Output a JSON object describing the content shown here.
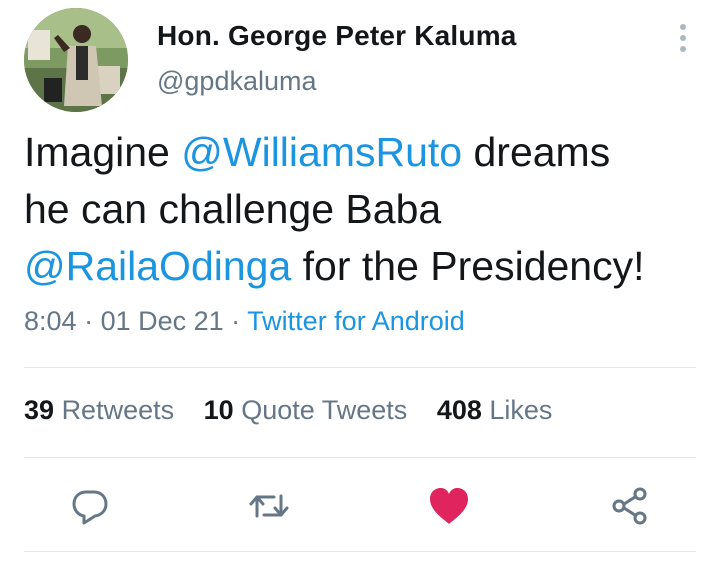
{
  "author": {
    "display_name": "Hon. George Peter Kaluma",
    "handle": "@gpdkaluma"
  },
  "tweet": {
    "line1_pre": "Imagine ",
    "mention1": "@WilliamsRuto",
    "line1_post": " dreams",
    "line2": "he can challenge Baba",
    "mention2": "@RailaOdinga",
    "line3_post": " for the Presidency!"
  },
  "meta": {
    "time": "8:04",
    "sep1": " · ",
    "date": "01 Dec 21",
    "sep2": " · ",
    "source": "Twitter for Android"
  },
  "stats": {
    "retweets_count": "39",
    "retweets_label": "Retweets",
    "quotes_count": "10",
    "quotes_label": "Quote Tweets",
    "likes_count": "408",
    "likes_label": "Likes"
  },
  "icons": {
    "reply": "reply-icon",
    "retweet": "retweet-icon",
    "like": "heart-icon",
    "share": "share-icon",
    "more": "more-vertical-icon"
  },
  "colors": {
    "mention": "#1b95e0",
    "like_active": "#e0245e",
    "muted": "#657786"
  }
}
